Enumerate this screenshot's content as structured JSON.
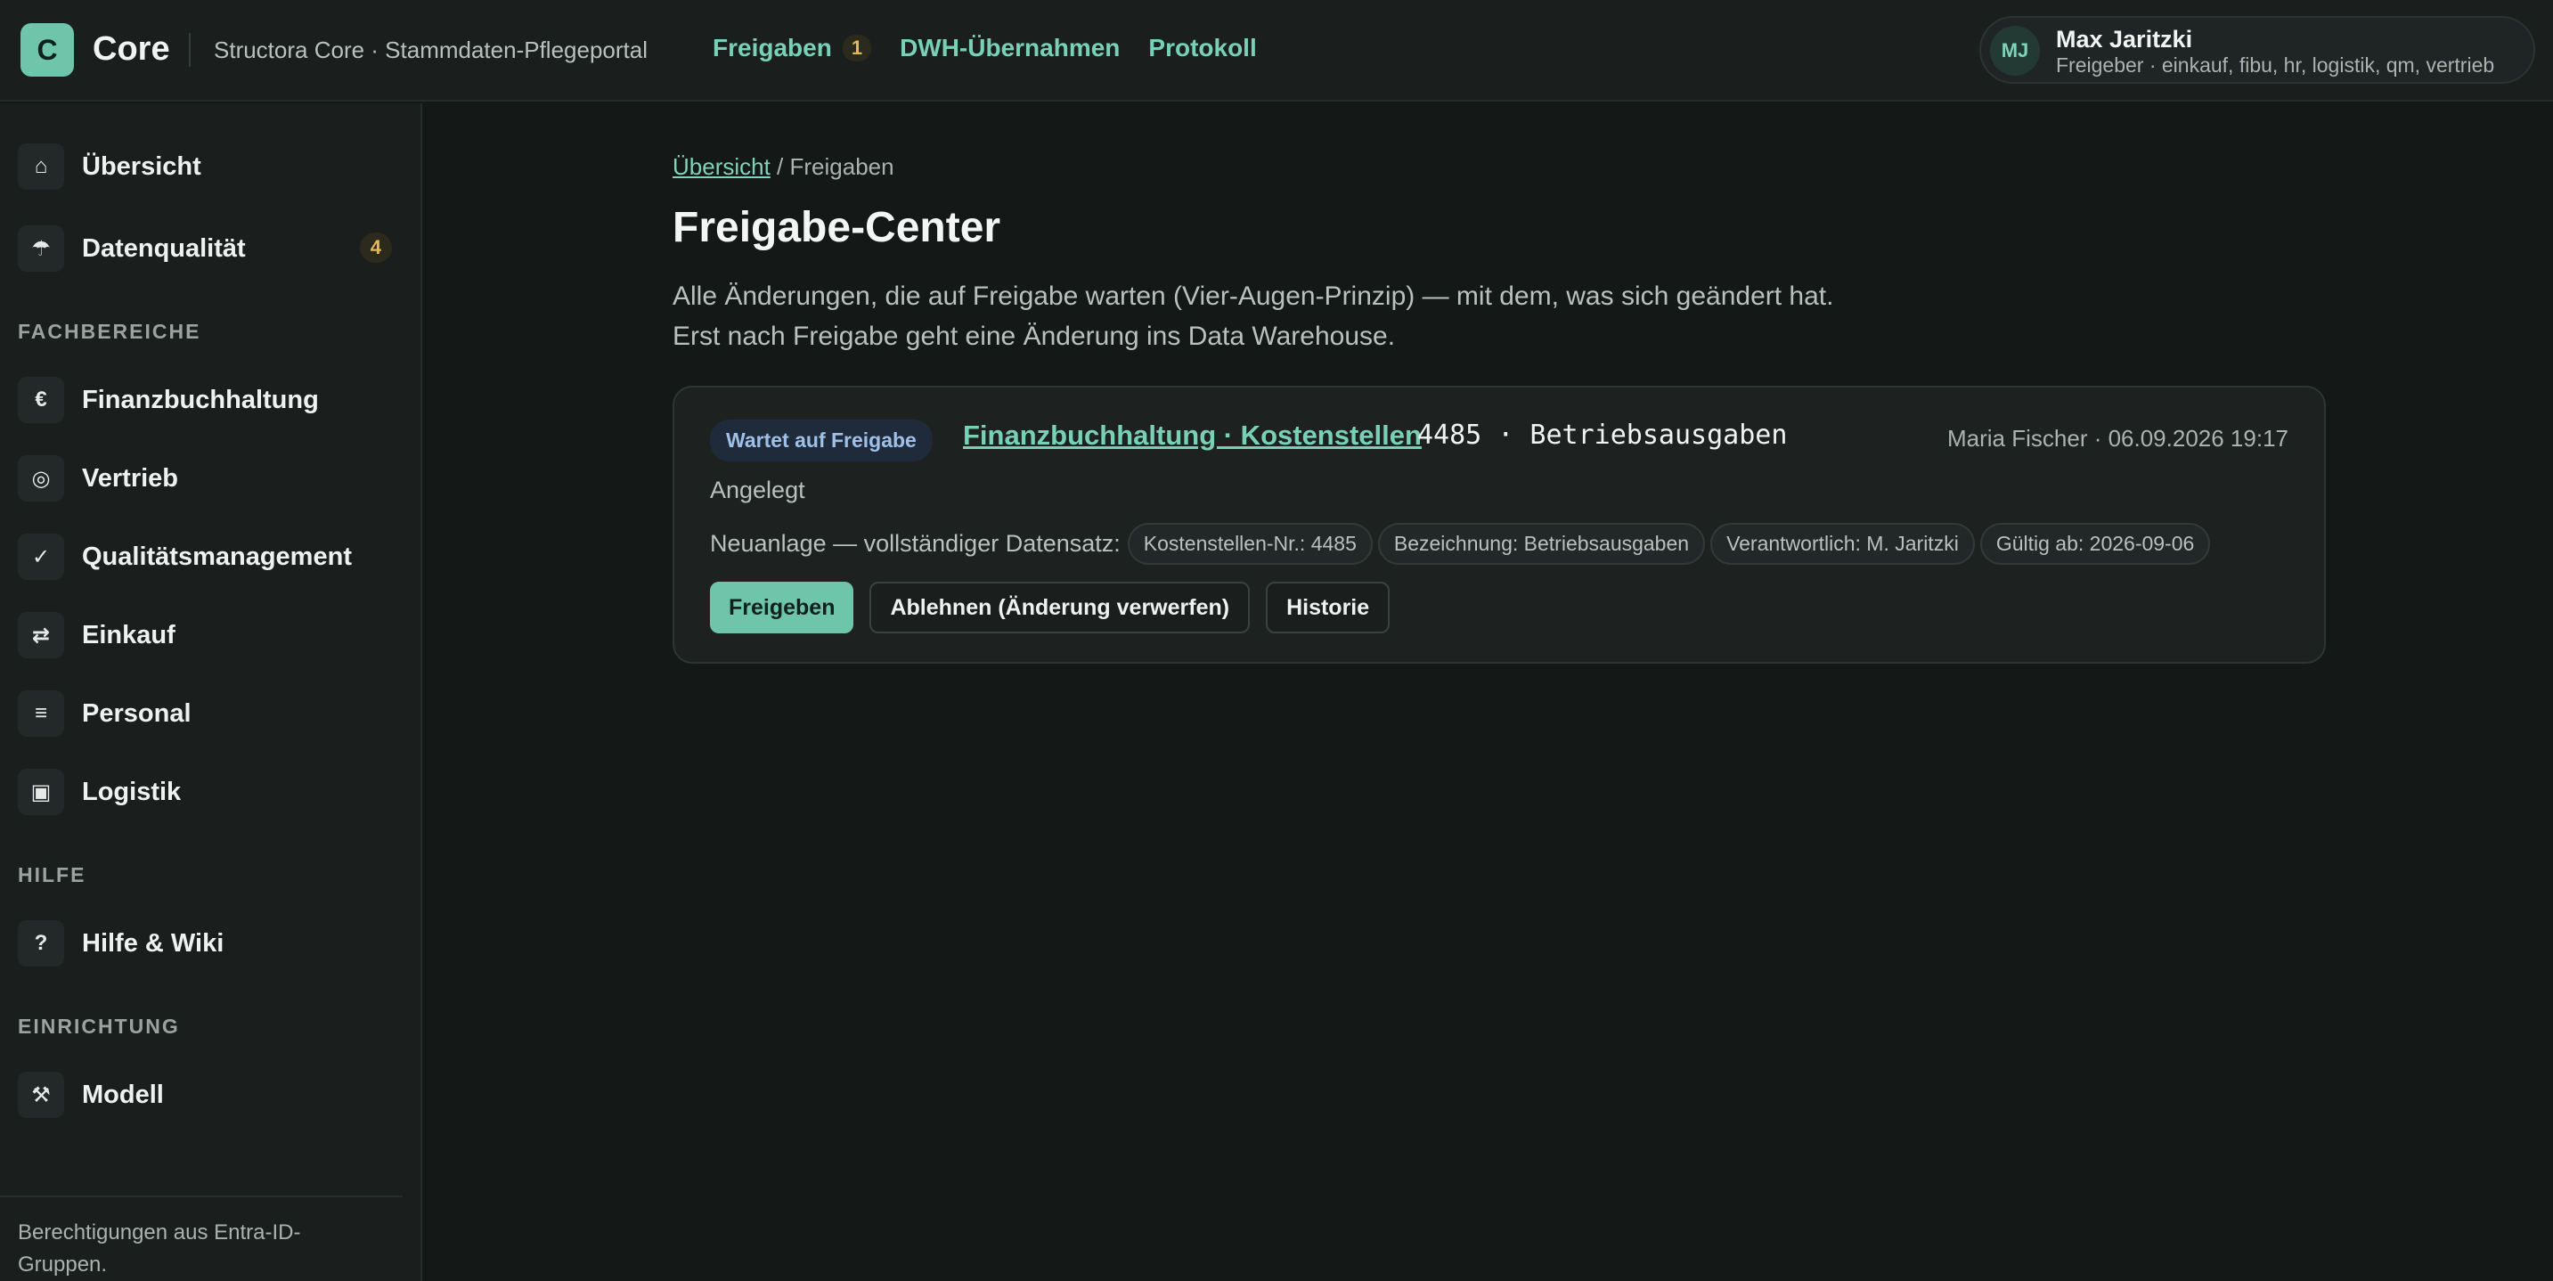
{
  "topbar": {
    "logo_letter": "C",
    "logo_text": "Core",
    "subtitle": "Structora Core · Stammdaten-Pflegeportal",
    "nav": [
      {
        "label": "Freigaben",
        "count": "1"
      },
      {
        "label": "DWH-Übernahmen"
      },
      {
        "label": "Protokoll"
      }
    ],
    "user": {
      "initials": "MJ",
      "name": "Max Jaritzki",
      "role": "Freigeber · einkauf, fibu, hr, logistik, qm, vertrieb"
    }
  },
  "sidebar": {
    "top_items": [
      {
        "label": "Übersicht",
        "icon": "⌂"
      },
      {
        "label": "Datenqualität",
        "icon": "☂",
        "badge": "4"
      }
    ],
    "sections": [
      {
        "title": "FACHBEREICHE",
        "items": [
          {
            "label": "Finanzbuchhaltung",
            "icon": "€"
          },
          {
            "label": "Vertrieb",
            "icon": "◎"
          },
          {
            "label": "Qualitätsmanagement",
            "icon": "✓"
          },
          {
            "label": "Einkauf",
            "icon": "⇄"
          },
          {
            "label": "Personal",
            "icon": "≡"
          },
          {
            "label": "Logistik",
            "icon": "▣"
          }
        ]
      },
      {
        "title": "HILFE",
        "items": [
          {
            "label": "Hilfe & Wiki",
            "icon": "?"
          }
        ]
      },
      {
        "title": "EINRICHTUNG",
        "items": [
          {
            "label": "Modell",
            "icon": "⚒"
          }
        ]
      }
    ],
    "footer": "Berechtigungen aus Entra-ID-Gruppen."
  },
  "main": {
    "breadcrumb": {
      "link": "Übersicht",
      "current": " / Freigaben"
    },
    "title": "Freigabe-Center",
    "description_1": "Alle Änderungen, die auf Freigabe warten (Vier-Augen-Prinzip) — mit dem, was sich geändert hat.",
    "description_2": "Erst nach Freigabe geht eine Änderung ins Data Warehouse.",
    "card": {
      "status": "Wartet auf Freigabe",
      "link": "Finanzbuchhaltung · Kostenstellen",
      "code": "4485 · Betriebsausgaben",
      "meta": "Maria Fischer · 06.09.2026 19:17",
      "state": "Angelegt",
      "chips_lead": "Neuanlage — vollständiger Datensatz:",
      "chips": [
        "Kostenstellen-Nr.: 4485",
        "Bezeichnung: Betriebsausgaben",
        "Verantwortlich: M. Jaritzki",
        "Gültig ab: 2026-09-06"
      ],
      "buttons": {
        "approve": "Freigeben",
        "reject": "Ablehnen (Änderung verwerfen)",
        "history": "Historie"
      }
    }
  }
}
